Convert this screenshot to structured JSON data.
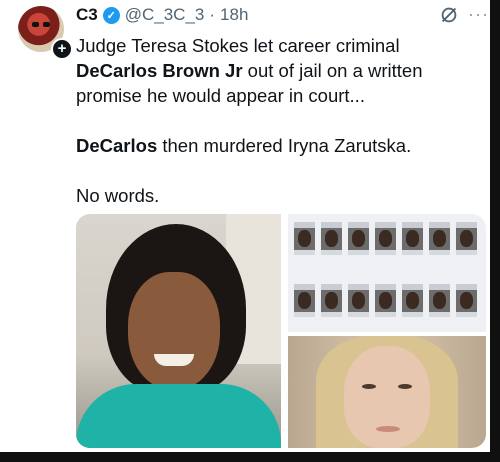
{
  "post": {
    "author_name": "C3",
    "handle": "@C_3C_3",
    "separator": "·",
    "time": "18h",
    "verified_icon": "verified-badge-icon",
    "follow_icon": "plus-icon",
    "grok_icon": "grok-icon",
    "more_icon": "more-icon",
    "text": {
      "line1": "Judge Teresa Stokes let career criminal",
      "line2_bold": "DeCarlos Brown Jr",
      "line2_rest": " out of jail on a written",
      "line3": "promise he would appear in court...",
      "line4_bold": "DeCarlos",
      "line4_rest": " then murdered Iryna Zarutska.",
      "line5": "No words."
    }
  },
  "media": {
    "images": [
      "smiling-woman-photo",
      "mugshot-grid",
      "young-woman-photo"
    ],
    "mugshot_count": 14
  },
  "colors": {
    "verified": "#1d9bf0",
    "text_primary": "#0f1419",
    "text_secondary": "#536471"
  }
}
